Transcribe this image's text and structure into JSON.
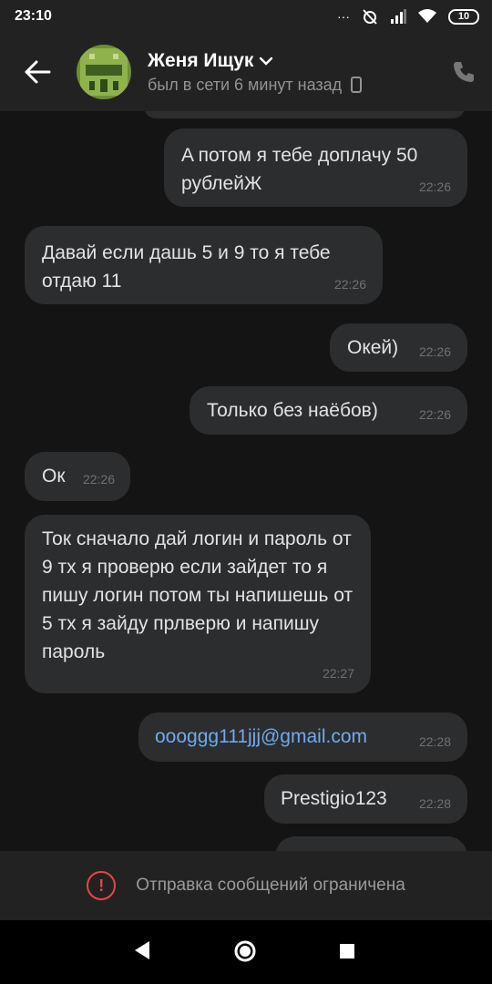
{
  "status_bar": {
    "time": "23:10",
    "battery": "10"
  },
  "header": {
    "contact_name": "Женя Ищук",
    "contact_status": "был в сети 6 минут назад"
  },
  "messages": [
    {
      "direction": "out",
      "text": "A потом я тебе доплачу 50 рублейЖ",
      "time": "22:26"
    },
    {
      "direction": "in",
      "text": "Давай если дашь 5 и 9 то я тебе отдаю 11",
      "time": "22:26"
    },
    {
      "direction": "out",
      "text": "Окей)",
      "time": "22:26"
    },
    {
      "direction": "out",
      "text": "Только без наёбов)",
      "time": "22:26"
    },
    {
      "direction": "in",
      "text": "Ок",
      "time": "22:26"
    },
    {
      "direction": "in",
      "text": "Ток сначало дай логин и пароль от 9 тх я проверю если зайдет то я пишу логин потом ты напишешь от 5 тх я зайду прлверю и напишу пароль",
      "time": "22:27"
    },
    {
      "direction": "out",
      "text": "oooggg111jjj@gmail.com",
      "time": "22:28",
      "is_link": true
    },
    {
      "direction": "out",
      "text": "Prestigio123",
      "time": "22:28"
    }
  ],
  "footer": {
    "restriction_text": "Отправка сообщений ограничена"
  },
  "colors": {
    "background": "#141414",
    "bar": "#222222",
    "bubble": "#2c2d2e",
    "link": "#71aaeb",
    "warning": "#e64646"
  },
  "icons": [
    "back-arrow-icon",
    "chevron-down-icon",
    "mobile-device-icon",
    "phone-icon",
    "warning-icon",
    "nav-back-icon",
    "nav-home-icon",
    "nav-recents-icon"
  ]
}
